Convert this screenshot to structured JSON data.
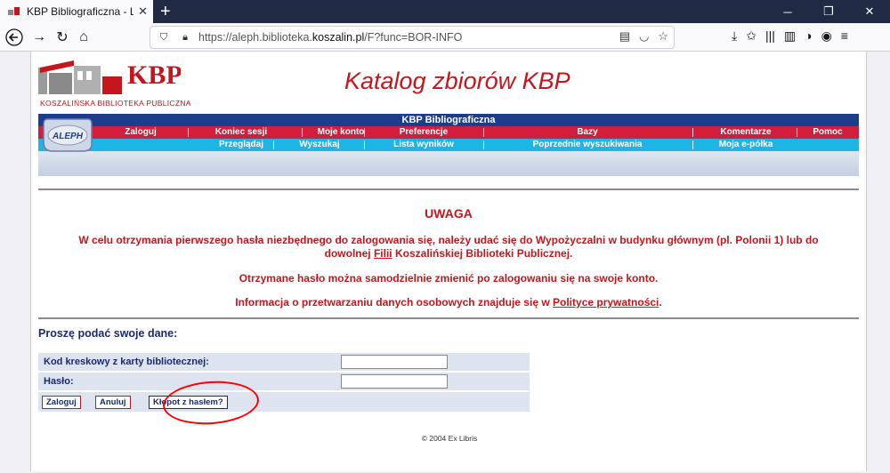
{
  "browser": {
    "tab_title": "KBP Bibliograficzna - Logowanie",
    "url_prefix": "https://aleph.biblioteka.",
    "url_domain": "koszalin.pl",
    "url_suffix": "/F?func=BOR-INFO"
  },
  "header": {
    "logo_text": "KBP",
    "logo_caption": "KOSZALIŃSKA BIBLIOTEKA PUBLICZNA",
    "catalog_title": "Katalog zbiorów KBP"
  },
  "menu": {
    "title": "KBP Bibliograficzna",
    "aleph_label": "ALEPH",
    "row1": [
      "Zaloguj",
      "Koniec sesji",
      "Moje konto",
      "Preferencje",
      "Bazy",
      "Komentarze",
      "Pomoc"
    ],
    "row2": [
      "Przeglądaj",
      "Wyszukaj",
      "Lista wyników",
      "Poprzednie wyszukiwania",
      "Moja e-półka"
    ]
  },
  "notice": {
    "heading": "UWAGA",
    "p1_a": "W celu otrzymania pierwszego hasła niezbędnego do zalogowania się, należy udać się do Wypożyczalni w budynku głównym (pl. Polonii 1) lub do dowolnej",
    "p1_link": "Filii",
    "p1_b": "Koszalińskiej Biblioteki Publicznej.",
    "p2": "Otrzymane hasło można samodzielnie zmienić po zalogowaniu się na swoje konto.",
    "p3_a": "Informacja o przetwarzaniu danych osobowych znajduje się w",
    "p3_link": "Polityce prywatności",
    "p3_b": "."
  },
  "form": {
    "heading": "Proszę podać swoje dane:",
    "barcode_label": "Kod kreskowy z karty bibliotecznej:",
    "barcode_value": "",
    "password_label": "Hasło:",
    "password_value": "",
    "login_button": "Zaloguj",
    "cancel_button": "Anuluj",
    "trouble_button": "Kłopot z hasłem?"
  },
  "footer": {
    "copyright": "© 2004 Ex Libris"
  },
  "colors": {
    "red": "#c4161c",
    "navy": "#1e3c8c",
    "menu_red": "#d21e3c",
    "menu_blue": "#1eb4e6"
  }
}
